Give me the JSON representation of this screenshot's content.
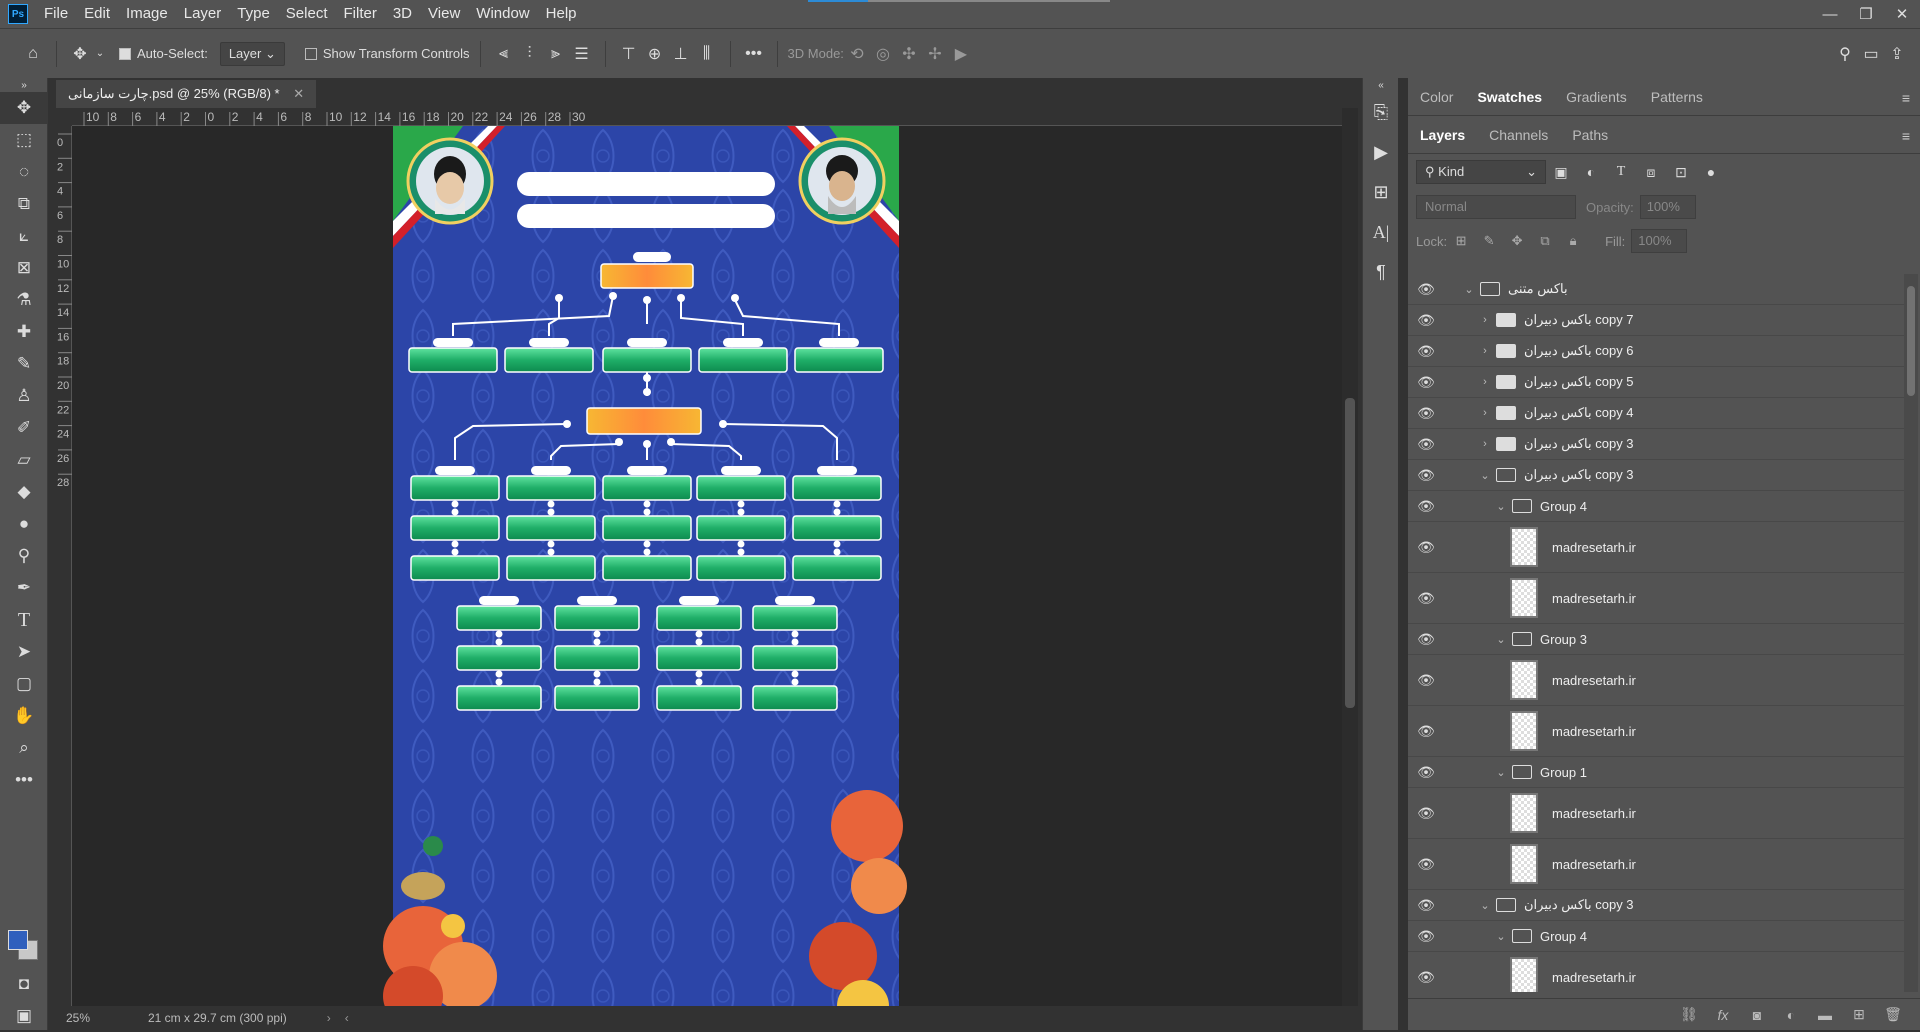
{
  "app": {
    "logo": "Ps"
  },
  "menu": [
    "File",
    "Edit",
    "Image",
    "Layer",
    "Type",
    "Select",
    "Filter",
    "3D",
    "View",
    "Window",
    "Help"
  ],
  "window_controls": {
    "minimize": "—",
    "restore": "❐",
    "close": "✕"
  },
  "options": {
    "auto_select_label": "Auto-Select:",
    "auto_select_checked": true,
    "auto_select_target": "Layer",
    "transform_controls_label": "Show Transform Controls",
    "more": "•••",
    "mode_3d_label": "3D Mode:"
  },
  "document": {
    "tab_title": "چارت سازمانی.psd @ 25% (RGB/8) *",
    "zoom": "25%",
    "doc_info": "21 cm x 29.7 cm (300 ppi)"
  },
  "rulers": {
    "top": [
      "10",
      "8",
      "6",
      "4",
      "2",
      "0",
      "2",
      "4",
      "6",
      "8",
      "10",
      "12",
      "14",
      "16",
      "18",
      "20",
      "22",
      "24",
      "26",
      "28",
      "30"
    ],
    "left": [
      "0",
      "2",
      "4",
      "6",
      "8",
      "10",
      "12",
      "14",
      "16",
      "18",
      "20",
      "22",
      "24",
      "26",
      "28"
    ]
  },
  "panels": {
    "top_tabs": [
      "Color",
      "Swatches",
      "Gradients",
      "Patterns"
    ],
    "top_active": "Swatches",
    "layer_tabs": [
      "Layers",
      "Channels",
      "Paths"
    ],
    "layer_active": "Layers",
    "kind_label": "Kind",
    "blend_mode": "Normal",
    "opacity_label": "Opacity:",
    "opacity_value": "100%",
    "lock_label": "Lock:",
    "fill_label": "Fill:",
    "fill_value": "100%"
  },
  "layers": [
    {
      "name": "باکس متنی",
      "kind": "folder",
      "indent": 0,
      "open": true
    },
    {
      "name": "باکس دبیران copy 7",
      "kind": "folder",
      "indent": 1,
      "open": false
    },
    {
      "name": "باکس دبیران copy 6",
      "kind": "folder",
      "indent": 1,
      "open": false
    },
    {
      "name": "باکس دبیران copy 5",
      "kind": "folder",
      "indent": 1,
      "open": false
    },
    {
      "name": "باکس دبیران copy 4",
      "kind": "folder",
      "indent": 1,
      "open": false
    },
    {
      "name": "باکس دبیران copy 3",
      "kind": "folder",
      "indent": 1,
      "open": false
    },
    {
      "name": "باکس دبیران copy 3",
      "kind": "folder",
      "indent": 1,
      "open": true
    },
    {
      "name": "Group 4",
      "kind": "folder",
      "indent": 2,
      "open": true
    },
    {
      "name": "madresetarh.ir",
      "kind": "pixel",
      "indent": 3
    },
    {
      "name": "madresetarh.ir",
      "kind": "pixel",
      "indent": 3
    },
    {
      "name": "Group 3",
      "kind": "folder",
      "indent": 2,
      "open": true
    },
    {
      "name": "madresetarh.ir",
      "kind": "pixel",
      "indent": 3
    },
    {
      "name": "madresetarh.ir",
      "kind": "pixel",
      "indent": 3
    },
    {
      "name": "Group 1",
      "kind": "folder",
      "indent": 2,
      "open": true
    },
    {
      "name": "madresetarh.ir",
      "kind": "pixel",
      "indent": 3
    },
    {
      "name": "madresetarh.ir",
      "kind": "pixel",
      "indent": 3
    },
    {
      "name": "باکس دبیران copy 3",
      "kind": "folder",
      "indent": 1,
      "open": true
    },
    {
      "name": "Group 4",
      "kind": "folder",
      "indent": 2,
      "open": true
    },
    {
      "name": "madresetarh.ir",
      "kind": "pixel",
      "indent": 3
    }
  ],
  "colors": {
    "foreground": "#2f5fbd",
    "background": "#c8c8c8",
    "poster_bg": "#2c45a8",
    "box_green": "#2ec27e",
    "box_orange": "#f5a623"
  }
}
